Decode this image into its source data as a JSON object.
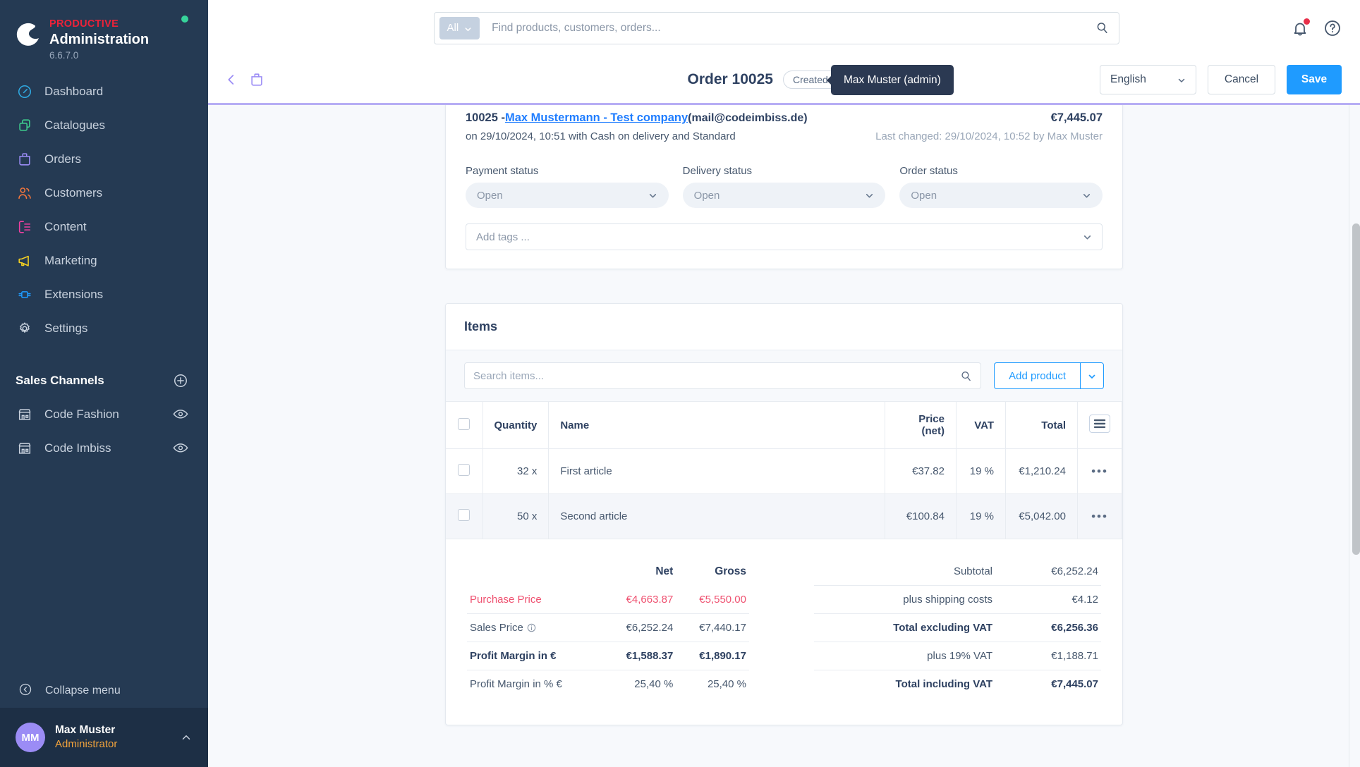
{
  "brand": {
    "kicker": "PRODUCTIVE",
    "title": "Administration",
    "version": "6.6.7.0",
    "accent_red": "#ed2239",
    "status_color": "#37d39b"
  },
  "sidebar": {
    "items": [
      {
        "label": "Dashboard",
        "icon": "gauge-icon",
        "color": "#2fa8e0"
      },
      {
        "label": "Catalogues",
        "icon": "copy-icon",
        "color": "#3ecf8e"
      },
      {
        "label": "Orders",
        "icon": "bag-icon",
        "color": "#9b8cf5"
      },
      {
        "label": "Customers",
        "icon": "users-icon",
        "color": "#f2763c"
      },
      {
        "label": "Content",
        "icon": "content-icon",
        "color": "#ef3fa0"
      },
      {
        "label": "Marketing",
        "icon": "megaphone-icon",
        "color": "#f5d021"
      },
      {
        "label": "Extensions",
        "icon": "plug-icon",
        "color": "#1f9bff"
      },
      {
        "label": "Settings",
        "icon": "gear-icon",
        "color": "#c9d2de"
      }
    ],
    "sales_channels": {
      "title": "Sales Channels",
      "add_icon": "plus-circle-icon",
      "channels": [
        {
          "label": "Code Fashion",
          "icon": "store-icon",
          "action_icon": "eye-icon"
        },
        {
          "label": "Code Imbiss",
          "icon": "store-icon",
          "action_icon": "eye-icon"
        }
      ]
    },
    "collapse_label": "Collapse menu",
    "collapse_icon": "chevron-circle-left-icon",
    "user": {
      "initials": "MM",
      "name": "Max Muster",
      "role": "Administrator",
      "caret_icon": "chevron-up-icon",
      "avatar_color": "#9b8cf5",
      "role_color": "#f2a33c"
    }
  },
  "topbar": {
    "scope_label": "All",
    "scope_caret_icon": "chevron-down-icon",
    "search_placeholder": "Find products, customers, orders...",
    "search_value": "",
    "search_icon": "search-icon",
    "notifications_icon": "bell-icon",
    "has_notification": true,
    "help_icon": "question-circle-icon"
  },
  "pagehead": {
    "back_icon": "chevron-left-icon",
    "module_icon": "bag-icon",
    "title": "Order 10025",
    "badge": "Created by admin",
    "tooltip": "Max Muster (admin)",
    "language": "English",
    "language_caret_icon": "chevron-down-icon",
    "cancel_label": "Cancel",
    "save_label": "Save",
    "save_color": "#1f9bff",
    "accent_underline": "#b7aef5"
  },
  "order": {
    "number": "10025 - ",
    "customer_link": "Max Mustermann - Test company",
    "email": " (mail@codeimbiss.de)",
    "total": "€7,445.07",
    "meta": "on 29/10/2024, 10:51 with Cash on delivery and Standard",
    "last_changed": "Last changed: 29/10/2024, 10:52 by Max Muster",
    "statuses": [
      {
        "label": "Payment status",
        "value": "Open"
      },
      {
        "label": "Delivery status",
        "value": "Open"
      },
      {
        "label": "Order status",
        "value": "Open"
      }
    ],
    "tags_placeholder": "Add tags ..."
  },
  "items": {
    "heading": "Items",
    "search_placeholder": "Search items...",
    "search_value": "",
    "search_icon": "search-icon",
    "add_product_label": "Add product",
    "add_product_caret_icon": "chevron-down-icon",
    "columns_icon": "list-settings-icon",
    "headers": {
      "quantity": "Quantity",
      "name": "Name",
      "price": "Price (net)",
      "vat": "VAT",
      "total": "Total"
    },
    "rows": [
      {
        "quantity": "32 x",
        "name": "First article",
        "price": "€37.82",
        "vat": "19 %",
        "total": "€1,210.24",
        "menu_icon": "more-horizontal-icon"
      },
      {
        "quantity": "50 x",
        "name": "Second article",
        "price": "€100.84",
        "vat": "19 %",
        "total": "€5,042.00",
        "menu_icon": "more-horizontal-icon"
      }
    ]
  },
  "totals_left": {
    "col_net": "Net",
    "col_gross": "Gross",
    "rows": [
      {
        "label": "Purchase Price",
        "net": "€4,663.87",
        "gross": "€5,550.00",
        "style": "red",
        "info": false
      },
      {
        "label": "Sales Price",
        "net": "€6,252.24",
        "gross": "€7,440.17",
        "style": "",
        "info": true,
        "info_icon": "info-circle-icon"
      },
      {
        "label": "Profit Margin in €",
        "net": "€1,588.37",
        "gross": "€1,890.17",
        "style": "bold",
        "info": false
      },
      {
        "label": "Profit Margin in % €",
        "net": "25,40 %",
        "gross": "25,40 %",
        "style": "",
        "info": false
      }
    ],
    "red_color": "#ef5170"
  },
  "totals_right": {
    "rows": [
      {
        "label": "Subtotal",
        "value": "€6,252.24",
        "style": ""
      },
      {
        "label": "plus shipping costs",
        "value": "€4.12",
        "style": ""
      },
      {
        "label": "Total excluding VAT",
        "value": "€6,256.36",
        "style": "bold"
      },
      {
        "label": "plus 19% VAT",
        "value": "€1,188.71",
        "style": ""
      },
      {
        "label": "Total including VAT",
        "value": "€7,445.07",
        "style": "bold"
      }
    ]
  }
}
